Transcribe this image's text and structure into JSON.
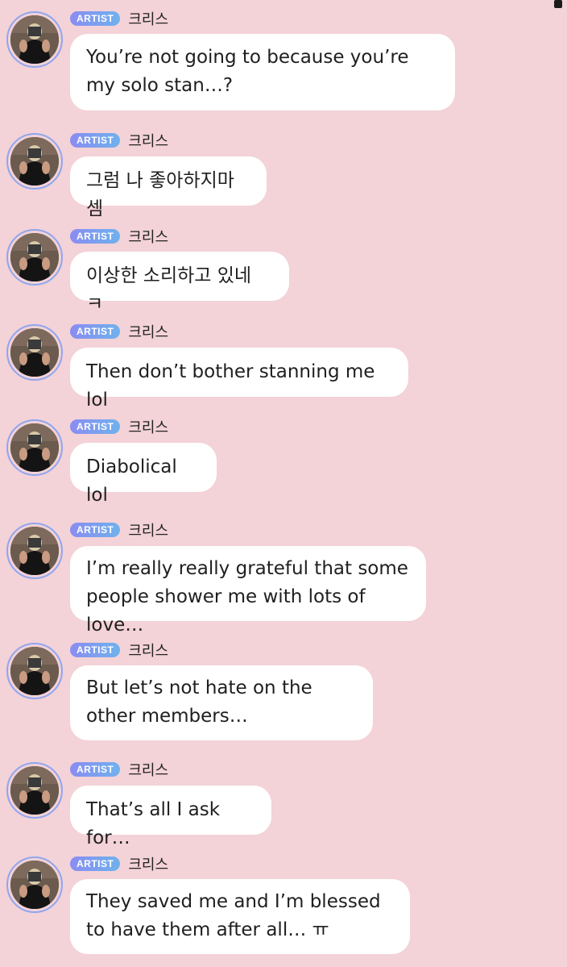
{
  "badge_label": "ARTIST",
  "sender_name": "크리스",
  "colors": {
    "background": "#f3d2d8",
    "bubble": "#ffffff",
    "badge_gradient_start": "#8a8cf2",
    "badge_gradient_end": "#6fb2ec",
    "avatar_ring": "#8fa6ee"
  },
  "messages": [
    {
      "text": "You’re not going to because you’re my solo stan…?"
    },
    {
      "text": "그럼 나 좋아하지마셈"
    },
    {
      "text": "이상한 소리하고 있네 ㅋ"
    },
    {
      "text": "Then don’t bother stanning me lol"
    },
    {
      "text": "Diabolical lol"
    },
    {
      "text": "I’m really really grateful that some people shower me with lots of love…"
    },
    {
      "text": "But let’s not hate on the other members…"
    },
    {
      "text": "That’s all I ask for…"
    },
    {
      "text": "They saved me and I’m blessed to have them after all… ㅠ"
    }
  ]
}
